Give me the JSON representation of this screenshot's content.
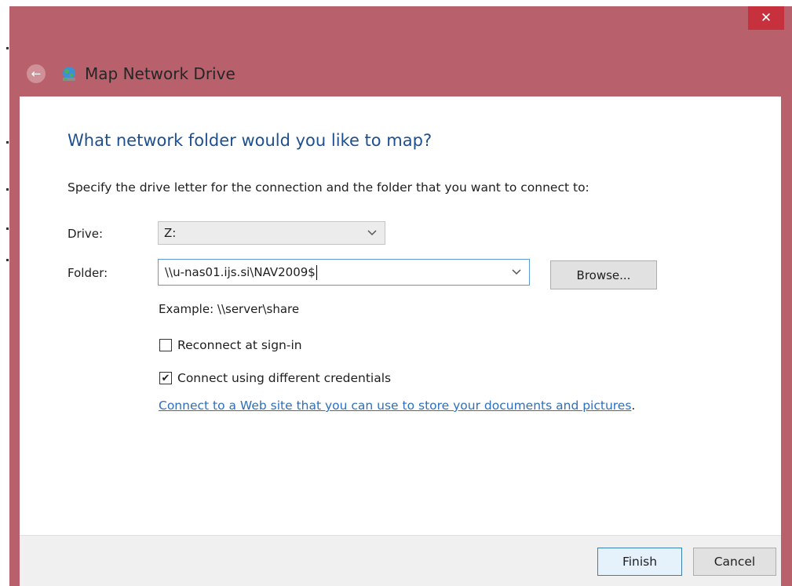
{
  "window": {
    "title": "Map Network Drive",
    "close_glyph": "✕",
    "back_glyph": "←",
    "accent_color": "#b8606b"
  },
  "main": {
    "heading": "What network folder would you like to map?",
    "instruction": "Specify the drive letter for the connection and the folder that you want to connect to:",
    "drive": {
      "label": "Drive:",
      "value": "Z:"
    },
    "folder": {
      "label": "Folder:",
      "value": "\\\\u-nas01.ijs.si\\NAV2009$",
      "browse_label": "Browse..."
    },
    "example": "Example: \\\\server\\share",
    "reconnect": {
      "label": "Reconnect at sign-in",
      "checked": false
    },
    "credentials": {
      "label": "Connect using different credentials",
      "checked": true,
      "check_glyph": "✔"
    },
    "link_text": "Connect to a Web site that you can use to store your documents and pictures",
    "link_suffix": "."
  },
  "footer": {
    "finish_label": "Finish",
    "cancel_label": "Cancel"
  },
  "icons": {
    "back": "back-arrow-icon",
    "app": "network-drive-globe-icon",
    "close": "close-icon",
    "dropdown": "chevron-down-icon",
    "check": "checkmark-icon"
  }
}
